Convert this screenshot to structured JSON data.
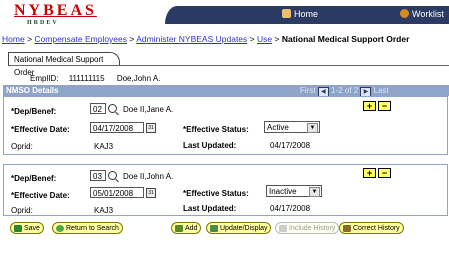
{
  "header": {
    "logo": "NYBEAS",
    "logo_sub": "HRDEV",
    "home": "Home",
    "worklist": "Worklist"
  },
  "breadcrumb": {
    "items": [
      "Home",
      "Compensate Employees",
      "Administer NYBEAS Updates",
      "Use"
    ],
    "separator": ">",
    "current": "National Medical Support Order"
  },
  "tab": {
    "label": "National Medical Support Order"
  },
  "employee": {
    "emplid_label": "EmplID:",
    "emplid": "111111115",
    "name": "Doe,John A."
  },
  "grid": {
    "title": "NMSO Details",
    "first": "First",
    "range": "1-2 of 2",
    "last": "Last",
    "prev_icon": "◀",
    "next_icon": "▶"
  },
  "labels": {
    "dep": "*Dep/Benef:",
    "eff_date": "*Effective Date:",
    "eff_status": "*Effective Status:",
    "oprid": "Oprid:",
    "last_updated": "Last Updated:"
  },
  "rows": [
    {
      "dep_id": "02",
      "dep_name": "Doe II,Jane A.",
      "eff_date": "04/17/2008",
      "status": "Active",
      "oprid": "KAJ3",
      "last_updated": "04/17/2008"
    },
    {
      "dep_id": "03",
      "dep_name": "Doe II,John A.",
      "eff_date": "05/01/2008",
      "status": "Inactive",
      "oprid": "KAJ3",
      "last_updated": "04/17/2008"
    }
  ],
  "buttons": {
    "save": "Save",
    "return": "Return to Search",
    "add": "Add",
    "update": "Update/Display",
    "include_history": "Include History",
    "correct_history": "Correct History"
  },
  "colors": {
    "brand_red": "#cc0000",
    "topbar": "#2b3a63",
    "grid_header": "#8fa4c9",
    "button_yellow": "#ffffa0",
    "link_blue": "#3333cc"
  }
}
